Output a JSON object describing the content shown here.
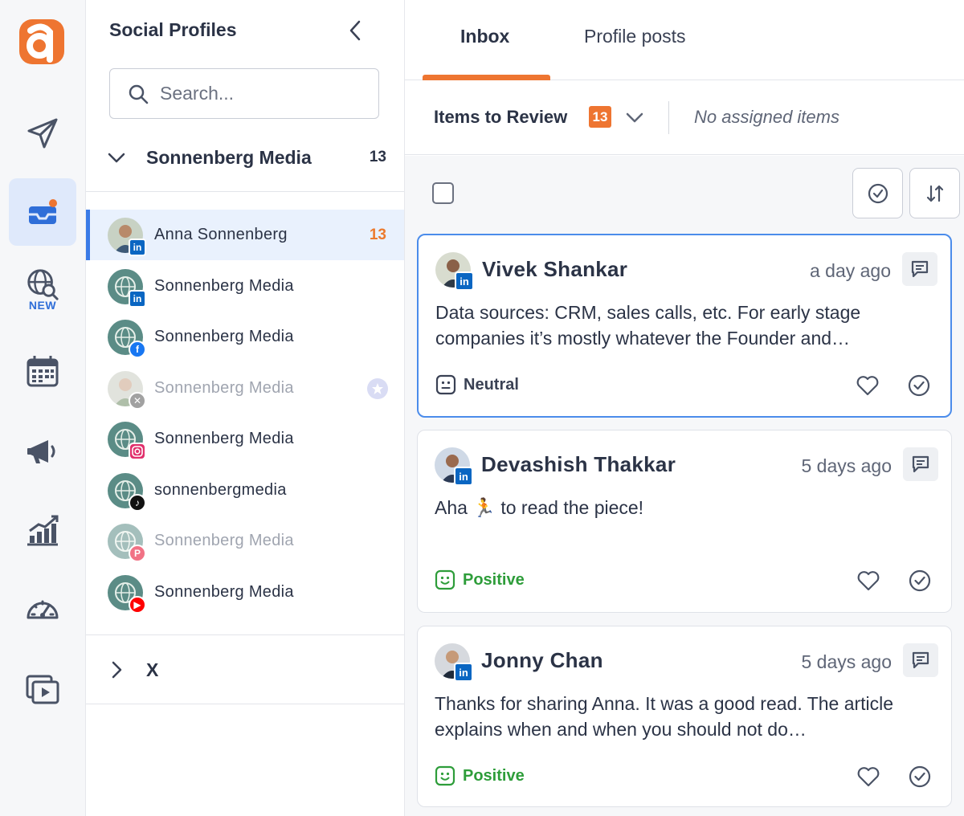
{
  "app": {
    "brand_letter": "a",
    "accent": "#ee7531",
    "rail": [
      {
        "icon": "paper-plane-icon"
      },
      {
        "icon": "inbox-icon",
        "active": true,
        "notification_dot": true
      },
      {
        "icon": "globe-search-icon",
        "badge": "NEW"
      },
      {
        "icon": "calendar-icon"
      },
      {
        "icon": "megaphone-icon"
      },
      {
        "icon": "analytics-chart-icon"
      },
      {
        "icon": "speedometer-icon"
      },
      {
        "icon": "video-library-icon"
      }
    ]
  },
  "profiles": {
    "title": "Social Profiles",
    "search_placeholder": "Search...",
    "group": {
      "name": "Sonnenberg Media",
      "count": "13",
      "expanded": true
    },
    "items": [
      {
        "name": "Anna Sonnenberg",
        "network": "linkedin",
        "count": "13",
        "selected": true
      },
      {
        "name": "Sonnenberg Media",
        "network": "linkedin"
      },
      {
        "name": "Sonnenberg Media",
        "network": "facebook"
      },
      {
        "name": "Sonnenberg Media",
        "network": "x",
        "dimmed": true,
        "star": true
      },
      {
        "name": "Sonnenberg Media",
        "network": "instagram"
      },
      {
        "name": "sonnenbergmedia",
        "network": "tiktok"
      },
      {
        "name": "Sonnenberg Media",
        "network": "pinterest",
        "dimmed": true
      },
      {
        "name": "Sonnenberg Media",
        "network": "youtube"
      }
    ],
    "group2": {
      "name": "X",
      "expanded": false
    }
  },
  "main": {
    "tabs": [
      {
        "label": "Inbox",
        "active": true
      },
      {
        "label": "Profile posts"
      }
    ],
    "filter": {
      "label": "Items to Review",
      "badge": "13",
      "assigned": "No assigned items"
    },
    "cards": [
      {
        "author": "Vivek Shankar",
        "time": "a day ago",
        "body": "Data sources: CRM, sales calls, etc. For early stage companies it’s mostly whatever the Founder and…",
        "sentiment": "Neutral",
        "sentiment_color": "#3a4154",
        "focused": true
      },
      {
        "author": "Devashish Thakkar",
        "time": "5 days ago",
        "body": "Aha 🏃 to read the piece!",
        "sentiment": "Positive",
        "sentiment_color": "#2e9d3a"
      },
      {
        "author": "Jonny Chan",
        "time": "5 days ago",
        "body": "Thanks for sharing Anna. It was a good read. The article explains when and when you should not do…",
        "sentiment": "Positive",
        "sentiment_color": "#2e9d3a"
      }
    ]
  }
}
